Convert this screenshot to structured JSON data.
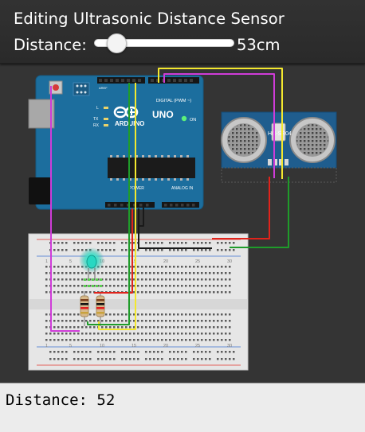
{
  "editor": {
    "title": "Editing Ultrasonic Distance Sensor",
    "distance_label": "Distance:",
    "slider_value_text": "53cm",
    "slider_fraction": 0.16
  },
  "arduino": {
    "brand": "ARDUINO",
    "model": "UNO",
    "digital_header": "DIGITAL (PWM ~)",
    "aref": "AREF",
    "gnd": "GND",
    "power_label": "POWER",
    "analog_label": "ANALOG IN",
    "on_label": "ON",
    "led_l": "L",
    "led_tx": "TX",
    "led_rx": "RX",
    "pin_numbers": [
      "13",
      "12",
      "~11",
      "~10",
      "~9",
      "8",
      "7",
      "~6",
      "~5",
      "4",
      "~3",
      "2",
      "TX→1",
      "RX←0"
    ],
    "power_pins": [
      "IOREF",
      "RESET",
      "3.3V",
      "5V",
      "GND",
      "GND",
      "Vin"
    ],
    "analog_pins": [
      "A0",
      "A1",
      "A2",
      "A3",
      "A4",
      "A5"
    ]
  },
  "sensor": {
    "model": "HC-SR04",
    "pins": [
      "VCC",
      "TRIG",
      "ECHO",
      "GND"
    ]
  },
  "breadboard": {
    "column_numbers": [
      "1",
      "5",
      "10",
      "15",
      "20",
      "25",
      "30"
    ],
    "row_letters": [
      "j",
      "i",
      "h",
      "g",
      "f",
      "e",
      "d",
      "c",
      "b",
      "a"
    ]
  },
  "wire_colors": {
    "yellow": "#f3e82e",
    "magenta": "#cf3cd8",
    "red": "#e0231b",
    "black": "#1a1a1a",
    "green": "#1f9c2a"
  },
  "serial": {
    "output": "Distance: 52"
  }
}
